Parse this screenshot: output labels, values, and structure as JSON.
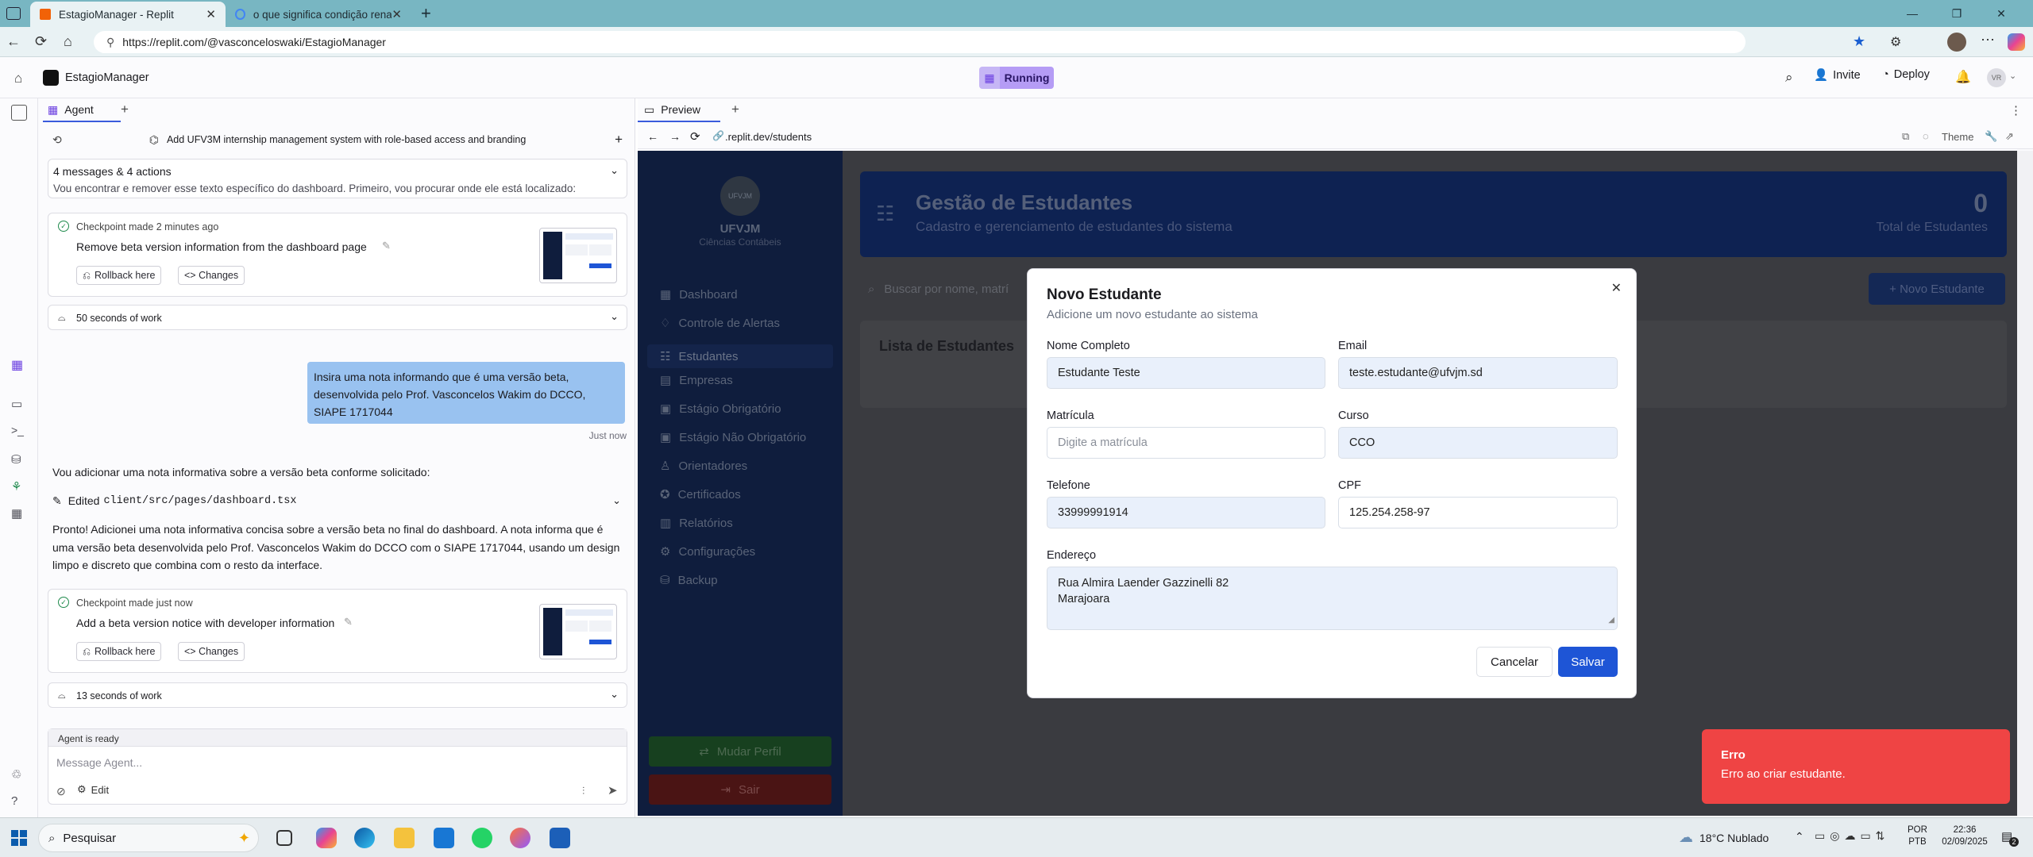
{
  "browser": {
    "tabs": [
      {
        "title": "EstagioManager - Replit",
        "active": true,
        "favicon_color": "#f26207"
      },
      {
        "title": "o que significa condição renal ag",
        "active": false,
        "favicon_color": "#4285f4"
      }
    ],
    "url": "https://replit.com/@vasconceloswaki/EstagioManager"
  },
  "replit": {
    "project_name": "EstagioManager",
    "run_status": "Running",
    "header_actions": {
      "invite": "Invite",
      "deploy": "Deploy",
      "avatar": "VR"
    },
    "agent_tab": "Agent",
    "preview_tab": "Preview",
    "preview_url": ".replit.dev/students",
    "theme_label": "Theme"
  },
  "agent": {
    "thread_title": "Add UFV3M internship management system with role-based access and branding",
    "summary_title": "4 messages & 4 actions",
    "summary_text": "Vou encontrar e remover esse texto específico do dashboard. Primeiro, vou procurar onde ele está localizado:",
    "checkpoint1": {
      "meta": "Checkpoint made 2 minutes ago",
      "desc": "Remove beta version information from the dashboard page",
      "rollback": "Rollback here",
      "changes": "<> Changes"
    },
    "work1": "50 seconds of work",
    "user_message": "Insira uma nota informando que é uma versão beta, desenvolvida pelo Prof. Vasconcelos Wakim do DCCO, SIAPE 1717044",
    "user_time": "Just now",
    "agent_reply": "Vou adicionar uma nota informativa sobre a versão beta conforme solicitado:",
    "edited_prefix": "Edited",
    "edited_file": "client/src/pages/dashboard.tsx",
    "agent_reply2": "Pronto! Adicionei uma nota informativa concisa sobre a versão beta no final do dashboard. A nota informa que é uma versão beta desenvolvida pelo Prof. Vasconcelos Wakim do DCCO com o SIAPE 1717044, usando um design limpo e discreto que combina com o resto da interface.",
    "checkpoint2": {
      "meta": "Checkpoint made just now",
      "desc": "Add a beta version notice with developer information",
      "rollback": "Rollback here",
      "changes": "<> Changes"
    },
    "work2": "13 seconds of work",
    "status": "Agent is ready",
    "input_placeholder": "Message Agent...",
    "edit_label": "Edit"
  },
  "app": {
    "brand": "UFVJM",
    "brand_sub": "Ciências Contábeis",
    "logo_text": "UFVJM",
    "nav": [
      "Dashboard",
      "Controle de Alertas",
      "Estudantes",
      "Empresas",
      "Estágio Obrigatório",
      "Estágio Não Obrigatório",
      "Orientadores",
      "Certificados",
      "Relatórios",
      "Configurações",
      "Backup"
    ],
    "profile_btn": "Mudar Perfil",
    "logout_btn": "Sair",
    "page_title": "Gestão de Estudantes",
    "page_subtitle": "Cadastro e gerenciamento de estudantes do sistema",
    "total_count": "0",
    "total_label": "Total de Estudantes",
    "search_placeholder": "Buscar por nome, matrí",
    "new_button": "+ Novo Estudante",
    "list_title": "Lista de Estudantes"
  },
  "modal": {
    "title": "Novo Estudante",
    "subtitle": "Adicione um novo estudante ao sistema",
    "fields": {
      "nome_label": "Nome Completo",
      "nome_value": "Estudante Teste",
      "email_label": "Email",
      "email_value": "teste.estudante@ufvjm.sd",
      "matricula_label": "Matrícula",
      "matricula_placeholder": "Digite a matrícula",
      "curso_label": "Curso",
      "curso_value": "CCO",
      "telefone_label": "Telefone",
      "telefone_value": "33999991914",
      "cpf_label": "CPF",
      "cpf_value": "125.254.258-97",
      "endereco_label": "Endereço",
      "endereco_line1": "Rua Almira Laender Gazzinelli 82",
      "endereco_line2": "Marajoara"
    },
    "cancel": "Cancelar",
    "save": "Salvar"
  },
  "toast": {
    "title": "Erro",
    "message": "Erro ao criar estudante."
  },
  "taskbar": {
    "search": "Pesquisar",
    "weather": "18°C  Nublado",
    "lang1": "POR",
    "lang2": "PTB",
    "time": "22:36",
    "date": "02/09/2025",
    "notif_count": "2"
  },
  "colors": {
    "accent": "#1e55d6",
    "toast": "#ef4444",
    "sidebar": "#0f1d3d"
  }
}
